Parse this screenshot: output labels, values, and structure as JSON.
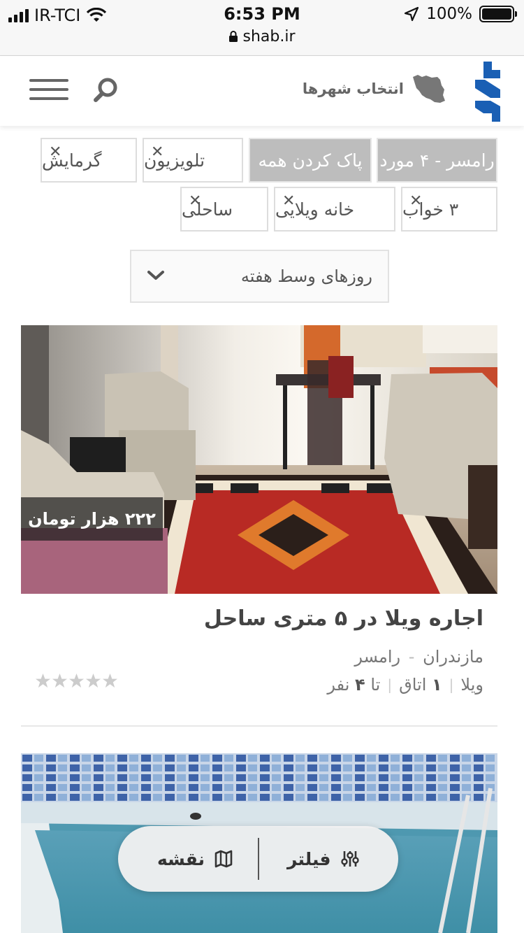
{
  "status_bar": {
    "carrier": "IR-TCI",
    "time": "6:53 PM",
    "url": "shab.ir",
    "battery": "100%",
    "battery_level": 1.0
  },
  "header": {
    "city_select_label": "انتخاب شهرها",
    "menu_icon": "hamburger-icon",
    "search_icon": "search-icon",
    "map_icon": "iran-map-icon",
    "logo": "shab-logo"
  },
  "filters": {
    "chips": [
      {
        "label": "رامسر - ۴ مورد",
        "removable": false
      },
      {
        "label": "پاک کردن همه",
        "removable": false
      },
      {
        "label": "تلویزیون",
        "removable": true
      },
      {
        "label": "گرمایش",
        "removable": true
      },
      {
        "label": "۳ خواب",
        "removable": true
      },
      {
        "label": "خانه ویلایی",
        "removable": true
      },
      {
        "label": "ساحلی",
        "removable": true
      }
    ],
    "day_select": "روزهای وسط هفته"
  },
  "listings": [
    {
      "price": "۲۲۲ هزار تومان",
      "title": "اجاره ویلا در ۵ متری ساحل",
      "province": "مازندران",
      "location_sep": "-",
      "city": "رامسر",
      "type": "ویلا",
      "rooms_num": "۱",
      "rooms_label": "اتاق",
      "capacity_prefix": "تا",
      "capacity_num": "۴",
      "capacity_label": "نفر",
      "rating": 0
    }
  ],
  "fab": {
    "filter_label": "فیلتر",
    "map_label": "نقشه"
  },
  "colors": {
    "brand_blue": "#1a5fb4",
    "chip_gray": "#bdbdbd",
    "star_gray": "#cccccc"
  }
}
